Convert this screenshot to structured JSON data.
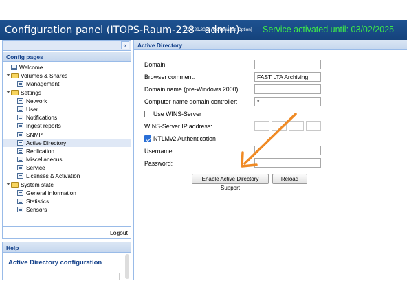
{
  "header": {
    "title": "Configuration panel (ITOPS-Raum-228 - admin)",
    "version": "2.00.29.8053 [Compliance Option]",
    "service_status": "Service activated until: 03/02/2025",
    "status_color": "#3ce84a",
    "bar_color": "#1a4b88"
  },
  "sidebar": {
    "collapse_icon": "double-chevron-left-icon",
    "collapse_glyph": "«",
    "title": "Config pages",
    "tree": [
      {
        "label": "Welcome",
        "level": 1,
        "type": "page"
      },
      {
        "label": "Volumes & Shares",
        "level": 0,
        "type": "folder",
        "expanded": true
      },
      {
        "label": "Management",
        "level": 1,
        "type": "page"
      },
      {
        "label": "Settings",
        "level": 0,
        "type": "folder",
        "expanded": true
      },
      {
        "label": "Network",
        "level": 1,
        "type": "page"
      },
      {
        "label": "User",
        "level": 1,
        "type": "page"
      },
      {
        "label": "Notifications",
        "level": 1,
        "type": "page"
      },
      {
        "label": "Ingest reports",
        "level": 1,
        "type": "page"
      },
      {
        "label": "SNMP",
        "level": 1,
        "type": "page"
      },
      {
        "label": "Active Directory",
        "level": 1,
        "type": "page",
        "selected": true
      },
      {
        "label": "Replication",
        "level": 1,
        "type": "page"
      },
      {
        "label": "Miscellaneous",
        "level": 1,
        "type": "page"
      },
      {
        "label": "Service",
        "level": 1,
        "type": "page"
      },
      {
        "label": "Licenses & Activation",
        "level": 1,
        "type": "page"
      },
      {
        "label": "System state",
        "level": 0,
        "type": "folder",
        "expanded": true
      },
      {
        "label": "General information",
        "level": 1,
        "type": "page"
      },
      {
        "label": "Statistics",
        "level": 1,
        "type": "page"
      },
      {
        "label": "Sensors",
        "level": 1,
        "type": "page"
      }
    ],
    "logout_label": "Logout"
  },
  "help": {
    "title": "Help",
    "content_title": "Active Directory configuration"
  },
  "main": {
    "title": "Active Directory",
    "fields": {
      "domain": {
        "label": "Domain:",
        "value": ""
      },
      "browser_comment": {
        "label": "Browser comment:",
        "value": "FAST LTA Archiving"
      },
      "domain_name_pre2000": {
        "label": "Domain name (pre-Windows 2000):",
        "value": ""
      },
      "computer_name_dc": {
        "label": "Computer name domain controller:",
        "value": "*"
      },
      "use_wins": {
        "label": "Use WINS-Server",
        "checked": false
      },
      "wins_ip": {
        "label": "WINS-Server IP address:",
        "octets": [
          "",
          "",
          "",
          ""
        ]
      },
      "ntlmv2": {
        "label": "NTLMv2 Authentication",
        "checked": true
      },
      "username": {
        "label": "Username:",
        "value": ""
      },
      "password": {
        "label": "Password:",
        "value": ""
      }
    },
    "buttons": {
      "enable_ad": "Enable Active Directory Support",
      "reload": "Reload"
    },
    "annotation_arrow_color": "#f08a24"
  }
}
